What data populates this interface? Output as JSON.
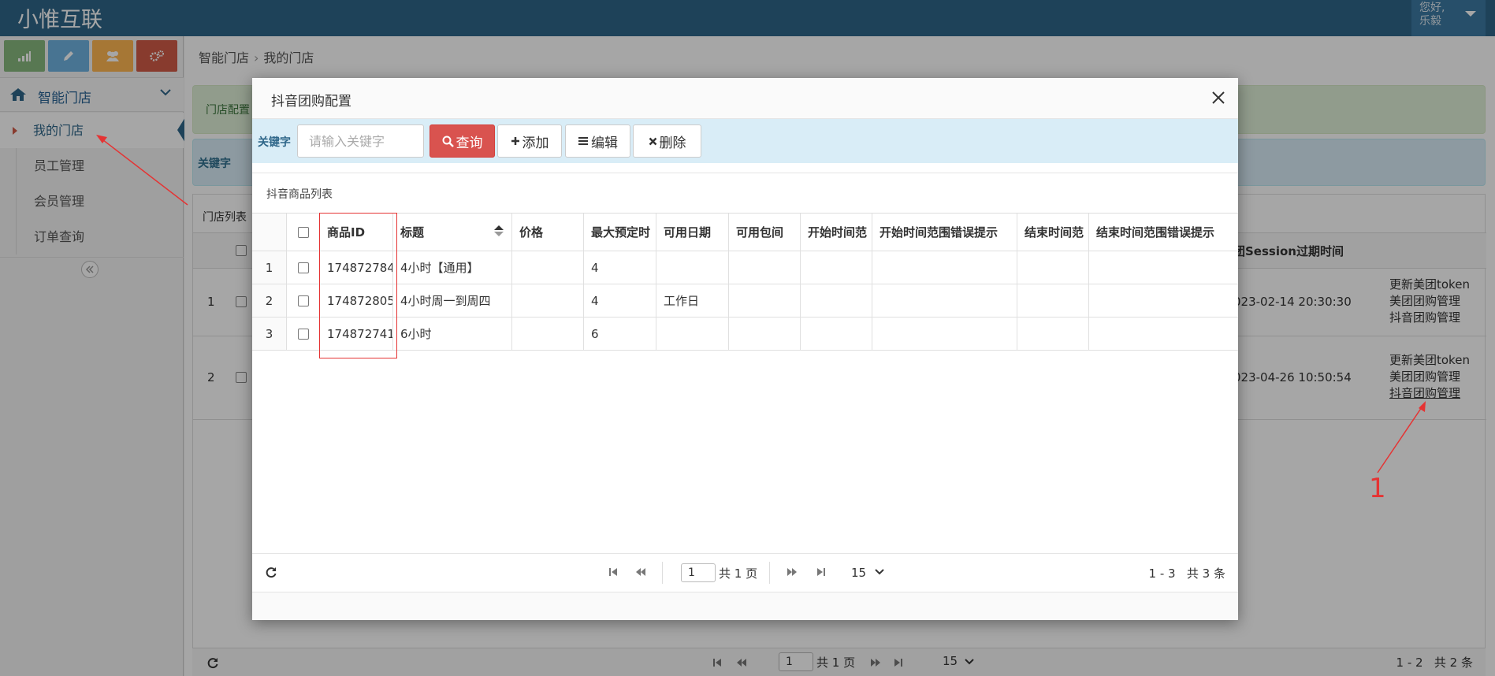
{
  "app": {
    "title": "小惟互联"
  },
  "user": {
    "greeting": "您好,",
    "name": "乐毅"
  },
  "sidebar": {
    "section": "智能门店",
    "items": [
      {
        "label": "我的门店",
        "active": true
      },
      {
        "label": "员工管理",
        "active": false
      },
      {
        "label": "会员管理",
        "active": false
      },
      {
        "label": "订单查询",
        "active": false
      }
    ]
  },
  "breadcrumb": {
    "parent": "智能门店",
    "current": "我的门店"
  },
  "background": {
    "alert_text": "门店配置",
    "keyword_label": "关键字",
    "panel_title": "门店列表",
    "session_column": "团Session过期时间",
    "rows": [
      {
        "num": "1",
        "time": "023-02-14 20:30:30",
        "actions": [
          "更新美团token",
          "美团团购管理",
          "抖音团购管理"
        ]
      },
      {
        "num": "2",
        "time": "023-04-26 10:50:54",
        "actions": [
          "更新美团token",
          "美团团购管理",
          "抖音团购管理"
        ]
      }
    ],
    "pager": {
      "page": "1",
      "total_pages": "共 1 页",
      "size": "15",
      "range": "1 - 2",
      "total": "共 2 条"
    }
  },
  "modal": {
    "title": "抖音团购配置",
    "toolbar": {
      "keyword_label": "关键字",
      "search_placeholder": "请输入关键字",
      "query": "查询",
      "add": "添加",
      "edit": "编辑",
      "delete": "删除"
    },
    "grid": {
      "title": "抖音商品列表",
      "columns": [
        "商品ID",
        "标题",
        "价格",
        "最大预定时",
        "可用日期",
        "可用包间",
        "开始时间范",
        "开始时间范围错误提示",
        "结束时间范",
        "结束时间范围错误提示"
      ],
      "rows": [
        {
          "num": "1",
          "id": "174872784",
          "title": "4小时【通用】",
          "price": "",
          "max": "4",
          "dates": "",
          "rooms": "",
          "start": "",
          "start_err": "",
          "end": "",
          "end_err": ""
        },
        {
          "num": "2",
          "id": "174872805",
          "title": "4小时周一到周四",
          "price": "",
          "max": "4",
          "dates": "工作日",
          "rooms": "",
          "start": "",
          "start_err": "",
          "end": "",
          "end_err": ""
        },
        {
          "num": "3",
          "id": "174872741",
          "title": "6小时",
          "price": "",
          "max": "6",
          "dates": "",
          "rooms": "",
          "start": "",
          "start_err": "",
          "end": "",
          "end_err": ""
        }
      ]
    },
    "pager": {
      "page": "1",
      "total_pages": "共 1 页",
      "size": "15",
      "range": "1 - 3",
      "total": "共 3 条"
    }
  },
  "annotation": {
    "label": "1",
    "color": "#e53333"
  },
  "colors": {
    "navbar": "#2e6689",
    "query_button": "#d9534f",
    "toolbar": "#d9edf7"
  }
}
